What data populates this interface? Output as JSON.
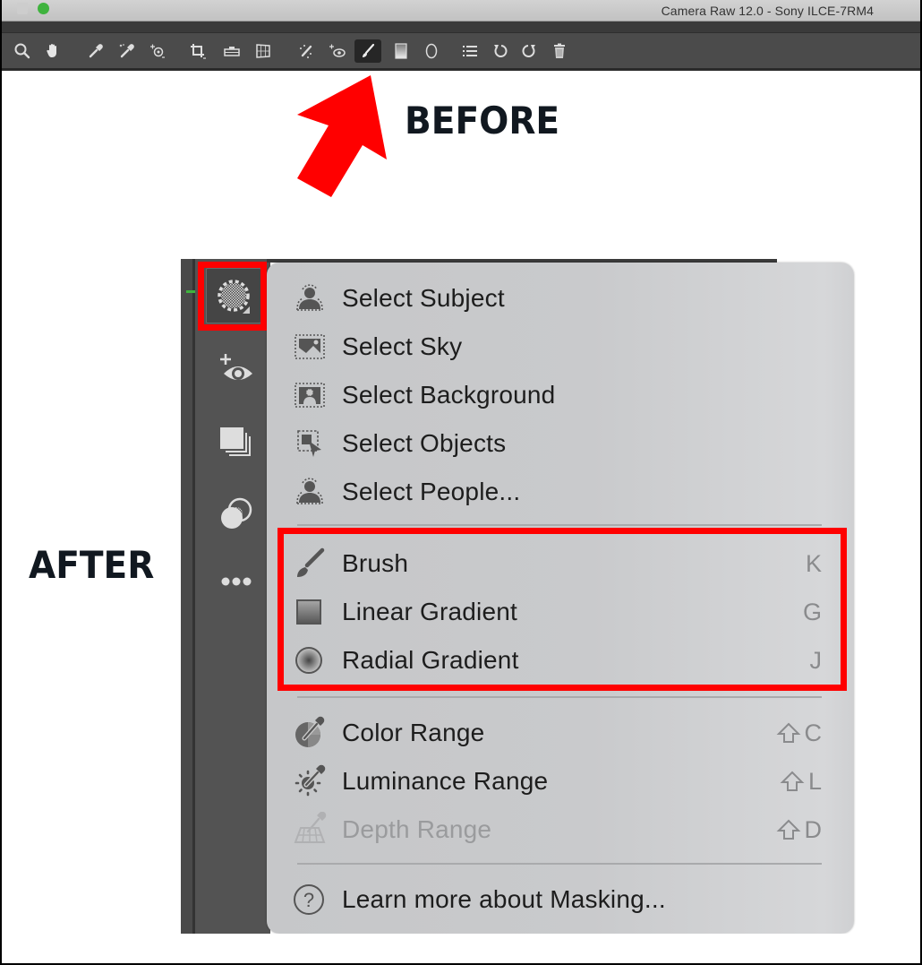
{
  "window": {
    "title": "Camera Raw 12.0  -  Sony ILCE-7RM4"
  },
  "toolbar": {
    "tools": [
      {
        "name": "zoom-tool",
        "icon": "magnifier-icon"
      },
      {
        "name": "hand-tool",
        "icon": "hand-icon"
      },
      {
        "name": "white-balance-tool",
        "icon": "eyedropper-icon"
      },
      {
        "name": "color-sampler-tool",
        "icon": "eyedropper-sparkle-icon"
      },
      {
        "name": "targeted-adjustment-tool",
        "icon": "target-adjust-icon"
      },
      {
        "name": "crop-tool",
        "icon": "crop-icon"
      },
      {
        "name": "straighten-tool",
        "icon": "level-icon"
      },
      {
        "name": "transform-tool",
        "icon": "transform-grid-icon"
      },
      {
        "name": "spot-removal-tool",
        "icon": "healing-brush-icon"
      },
      {
        "name": "red-eye-tool",
        "icon": "red-eye-icon"
      },
      {
        "name": "adjustment-brush-tool",
        "icon": "brush-icon",
        "active": true
      },
      {
        "name": "graduated-filter-tool",
        "icon": "linear-gradient-icon"
      },
      {
        "name": "radial-filter-tool",
        "icon": "radial-filter-icon"
      },
      {
        "name": "preferences-tool",
        "icon": "list-icon"
      },
      {
        "name": "rotate-left-tool",
        "icon": "rotate-ccw-icon"
      },
      {
        "name": "rotate-right-tool",
        "icon": "rotate-cw-icon"
      },
      {
        "name": "delete-tool",
        "icon": "trash-icon"
      }
    ]
  },
  "annotations": {
    "before": "BEFORE",
    "after": "AFTER",
    "highlight_color": "#ff0000"
  },
  "side_toolbar": {
    "items": [
      {
        "name": "masking",
        "icon": "masking-circle-icon",
        "selected": true
      },
      {
        "name": "red-eye",
        "icon": "red-eye-plus-icon"
      },
      {
        "name": "snapshots",
        "icon": "snapshots-icon"
      },
      {
        "name": "presets",
        "icon": "presets-overlap-icon"
      },
      {
        "name": "more",
        "icon": "more-dots-icon"
      }
    ]
  },
  "mask_menu": {
    "groups": [
      [
        {
          "label": "Select Subject",
          "icon": "select-subject-icon",
          "shortcut": ""
        },
        {
          "label": "Select Sky",
          "icon": "select-sky-icon",
          "shortcut": ""
        },
        {
          "label": "Select Background",
          "icon": "select-background-icon",
          "shortcut": ""
        },
        {
          "label": "Select Objects",
          "icon": "select-objects-icon",
          "shortcut": ""
        },
        {
          "label": "Select People...",
          "icon": "select-people-icon",
          "shortcut": ""
        }
      ],
      [
        {
          "label": "Brush",
          "icon": "brush-icon",
          "shortcut": "K"
        },
        {
          "label": "Linear Gradient",
          "icon": "linear-gradient-icon",
          "shortcut": "G"
        },
        {
          "label": "Radial Gradient",
          "icon": "radial-gradient-icon",
          "shortcut": "J"
        }
      ],
      [
        {
          "label": "Color Range",
          "icon": "color-range-icon",
          "shortcut": "C",
          "shift": true
        },
        {
          "label": "Luminance Range",
          "icon": "luminance-range-icon",
          "shortcut": "L",
          "shift": true
        },
        {
          "label": "Depth Range",
          "icon": "depth-range-icon",
          "shortcut": "D",
          "shift": true,
          "disabled": true
        }
      ],
      [
        {
          "label": "Learn more about Masking...",
          "icon": "help-circle-icon",
          "shortcut": ""
        }
      ]
    ]
  }
}
